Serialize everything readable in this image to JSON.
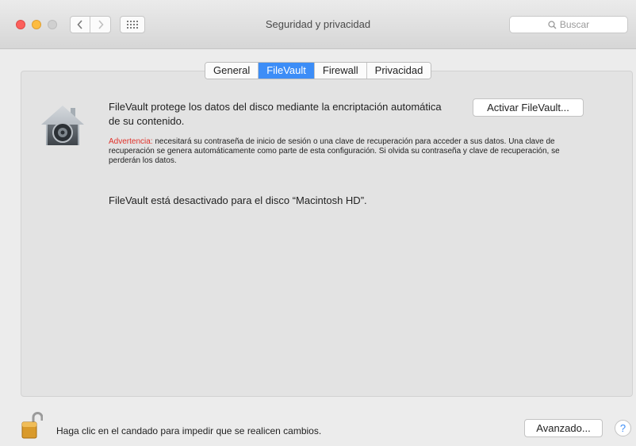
{
  "window": {
    "title": "Seguridad y privacidad",
    "search_placeholder": "Buscar"
  },
  "tabs": [
    {
      "label": "General",
      "active": false
    },
    {
      "label": "FileVault",
      "active": true
    },
    {
      "label": "Firewall",
      "active": false
    },
    {
      "label": "Privacidad",
      "active": false
    }
  ],
  "filevault": {
    "description": "FileVault protege los datos del disco mediante la encriptación automática de su contenido.",
    "activate_button": "Activar FileVault...",
    "warning_label": "Advertencia:",
    "warning_text": " necesitará su contraseña de inicio de sesión o una clave de recuperación para acceder a sus datos. Una clave de recuperación se genera automáticamente como parte de esta configuración. Si olvida su contraseña y clave de recuperación, se perderán los datos.",
    "status": "FileVault está desactivado para el disco “Macintosh HD”."
  },
  "footer": {
    "lock_message": "Haga clic en el candado para impedir que se realicen cambios.",
    "advanced_button": "Avanzado...",
    "help_label": "?"
  },
  "colors": {
    "accent": "#3c8df7",
    "warning": "#e0322b",
    "close": "#fc605c",
    "minimize": "#fdbc40"
  },
  "icons": [
    "back-icon",
    "forward-icon",
    "grid-icon",
    "search-icon",
    "filevault-house-icon",
    "lock-icon",
    "help-icon"
  ]
}
